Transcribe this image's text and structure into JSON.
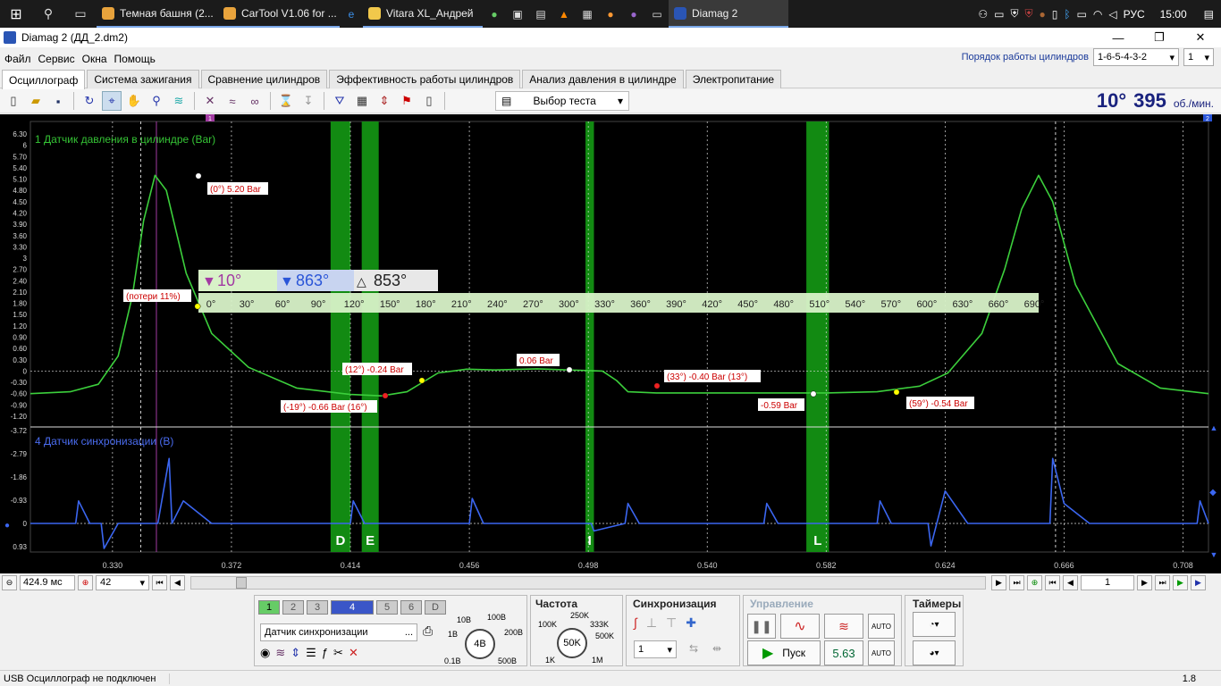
{
  "taskbar": {
    "tasks": [
      {
        "label": "Темная башня (2..."
      },
      {
        "label": "CarTool V1.06 for ..."
      },
      {
        "label": "Vitara XL_Андрей"
      },
      {
        "label": "Diamag 2"
      }
    ],
    "lang": "РУС",
    "clock": "15:00"
  },
  "window": {
    "title": "Diamag 2 (ДД_2.dm2)",
    "minimize": "—",
    "maximize": "❐",
    "close": "✕"
  },
  "menu": {
    "items": [
      "Файл",
      "Сервис",
      "Окна",
      "Помощь"
    ],
    "cyl_order_label": "Порядок работы цилиндров",
    "cyl_order_value": "1-6-5-4-3-2",
    "cyl_number": "1"
  },
  "tabs": [
    "Осциллограф",
    "Система зажигания",
    "Сравнение цилиндров",
    "Эффективность работы цилиндров",
    "Анализ давления в цилиндре",
    "Электропитание"
  ],
  "toolbar": {
    "test_select": "Выбор теста",
    "rpm_angle": "10°",
    "rpm_value": "395",
    "rpm_unit": "об./мин."
  },
  "scope": {
    "ch1_label": "1 Датчик давления в цилиндре (Bar)",
    "ch4_label": "4 Датчик синхронизации (В)",
    "marker_top_1": "1",
    "marker_top_2": "2",
    "ch1_ticks": [
      "6.30",
      "6",
      "5.70",
      "5.40",
      "5.10",
      "4.80",
      "4.50",
      "4.20",
      "3.90",
      "3.60",
      "3.30",
      "3",
      "2.70",
      "2.40",
      "2.10",
      "1.80",
      "1.50",
      "1.20",
      "0.90",
      "0.60",
      "0.30",
      "0",
      "-0.30",
      "-0.60",
      "-0.90",
      "-1.20"
    ],
    "ch4_ticks": [
      "-3.72",
      "-2.79",
      "-1.86",
      "-0.93",
      "0",
      "0.93"
    ],
    "time_ticks": [
      "0.330",
      "0.372",
      "0.414",
      "0.456",
      "0.498",
      "0.540",
      "0.582",
      "0.624",
      "0.666",
      "0.708"
    ],
    "angle_ticks": [
      "0°",
      "30°",
      "60°",
      "90°",
      "120°",
      "150°",
      "180°",
      "210°",
      "240°",
      "270°",
      "300°",
      "330°",
      "360°",
      "390°",
      "420°",
      "450°",
      "480°",
      "510°",
      "540°",
      "570°",
      "600°",
      "630°",
      "660°",
      "690°"
    ],
    "cursor_a": "10°",
    "cursor_b": "863°",
    "cursor_delta": "853°",
    "zones": [
      "D",
      "E",
      "I",
      "L"
    ],
    "annotations": [
      "(0°) 5.20 Bar",
      "(потери 11%)",
      "(12°) -0.24 Bar",
      "(-19°) -0.66 Bar (16°)",
      "0.06 Bar",
      "(33°) -0.40 Bar (13°)",
      "-0.59 Bar",
      "(59°) -0.54 Bar"
    ]
  },
  "chart_data": {
    "type": "line",
    "title": "",
    "xlabel": "",
    "ylabel": "",
    "x_unit": "s",
    "xlim": [
      0.301,
      0.717
    ],
    "series": [
      {
        "name": "1 Датчик давления в цилиндре (Bar)",
        "x": [
          0.301,
          0.315,
          0.325,
          0.332,
          0.337,
          0.341,
          0.345,
          0.349,
          0.356,
          0.365,
          0.378,
          0.395,
          0.414,
          0.425,
          0.434,
          0.445,
          0.455,
          0.465,
          0.48,
          0.495,
          0.503,
          0.508,
          0.512,
          0.522,
          0.54,
          0.56,
          0.582,
          0.6,
          0.615,
          0.625,
          0.637,
          0.645,
          0.651,
          0.657,
          0.662,
          0.67,
          0.685,
          0.7,
          0.717
        ],
        "values": [
          -0.6,
          -0.55,
          -0.35,
          0.4,
          2.0,
          4.0,
          5.2,
          4.8,
          2.6,
          1.0,
          0.1,
          -0.45,
          -0.62,
          -0.66,
          -0.55,
          -0.05,
          0.05,
          0.03,
          0.06,
          0.02,
          0.0,
          -0.25,
          -0.55,
          -0.58,
          -0.58,
          -0.58,
          -0.58,
          -0.55,
          -0.4,
          -0.05,
          1.0,
          2.7,
          4.3,
          5.2,
          4.5,
          2.3,
          0.2,
          -0.45,
          -0.6
        ]
      },
      {
        "name": "4 Датчик синхронизации (В)",
        "x": [
          0.301,
          0.317,
          0.318,
          0.322,
          0.326,
          0.327,
          0.332,
          0.346,
          0.35,
          0.351,
          0.355,
          0.365,
          0.414,
          0.415,
          0.419,
          0.456,
          0.457,
          0.461,
          0.499,
          0.5,
          0.511,
          0.512,
          0.516,
          0.54,
          0.56,
          0.561,
          0.565,
          0.6,
          0.601,
          0.605,
          0.618,
          0.619,
          0.624,
          0.632,
          0.661,
          0.662,
          0.666,
          0.675,
          0.713,
          0.714,
          0.717
        ],
        "values": [
          0,
          0,
          -0.9,
          0,
          0,
          1.0,
          0,
          0,
          -2.6,
          0,
          -0.9,
          0,
          0,
          -0.9,
          0,
          0,
          -1.0,
          0,
          0,
          0.3,
          0,
          -0.8,
          0,
          0,
          0,
          -0.8,
          0,
          0,
          -0.9,
          0,
          0,
          0.9,
          -1.3,
          0,
          0,
          -2.6,
          -0.8,
          0,
          0,
          -0.9,
          0
        ]
      }
    ],
    "ch1_ylim": [
      -1.2,
      6.3
    ],
    "ch4_ylim": [
      -3.72,
      0.93
    ]
  },
  "channels": {
    "buttons": [
      "1",
      "2",
      "3",
      "4",
      "5",
      "6",
      "D"
    ],
    "sensor_select": "Датчик синхронизации",
    "ellipsis": "...",
    "voltage_labels": [
      "10В",
      "100В",
      "200В",
      "1В",
      "500В",
      "0.1В"
    ],
    "voltage_value": "4В"
  },
  "frequency": {
    "title": "Частота",
    "labels": [
      "250K",
      "100K",
      "333K",
      "500K",
      "1K",
      "1M"
    ],
    "value": "50K"
  },
  "sync": {
    "title": "Синхронизация",
    "channel": "1"
  },
  "control": {
    "title": "Управление",
    "start": "Пуск",
    "value": "5.63",
    "auto": "AUTO"
  },
  "timers": {
    "title": "Таймеры"
  },
  "bottom": {
    "time_span": "424.9 мс",
    "points": "42",
    "page": "1"
  },
  "status": {
    "text": "USB Осциллограф не подключен",
    "version": "1.8"
  }
}
